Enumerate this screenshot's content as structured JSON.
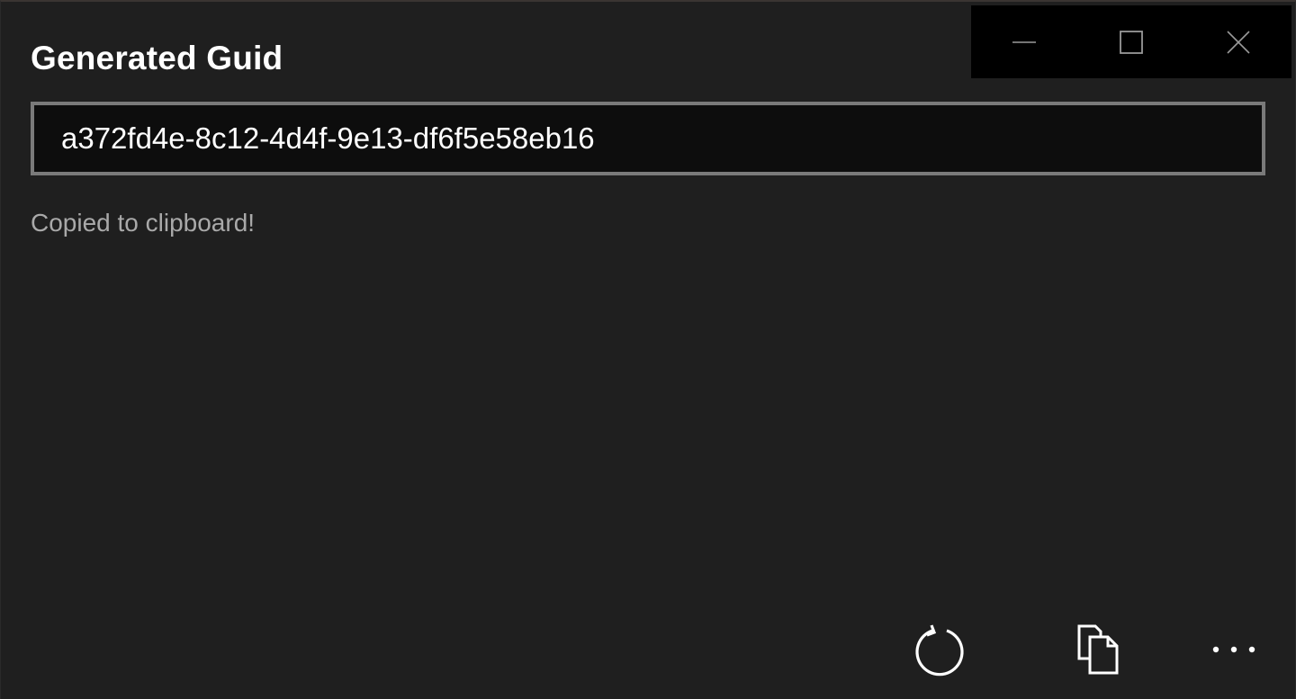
{
  "window": {
    "caption_buttons": [
      {
        "name": "minimize",
        "icon": "minimize-icon"
      },
      {
        "name": "maximize",
        "icon": "maximize-icon"
      },
      {
        "name": "close",
        "icon": "close-icon"
      }
    ]
  },
  "main": {
    "title": "Generated Guid",
    "guid_value": "a372fd4e-8c12-4d4f-9e13-df6f5e58eb16",
    "status": "Copied to clipboard!"
  },
  "command_bar": {
    "items": [
      {
        "name": "refresh",
        "icon": "refresh-icon"
      },
      {
        "name": "copy",
        "icon": "copy-icon"
      },
      {
        "name": "more",
        "icon": "more-icon"
      }
    ]
  },
  "colors": {
    "background": "#1f1f1f",
    "title_text": "#ffffff",
    "status_text": "#a9a9a9",
    "input_border": "#7a7a7a",
    "input_background": "#0d0d0d",
    "caption_background": "#000000"
  }
}
